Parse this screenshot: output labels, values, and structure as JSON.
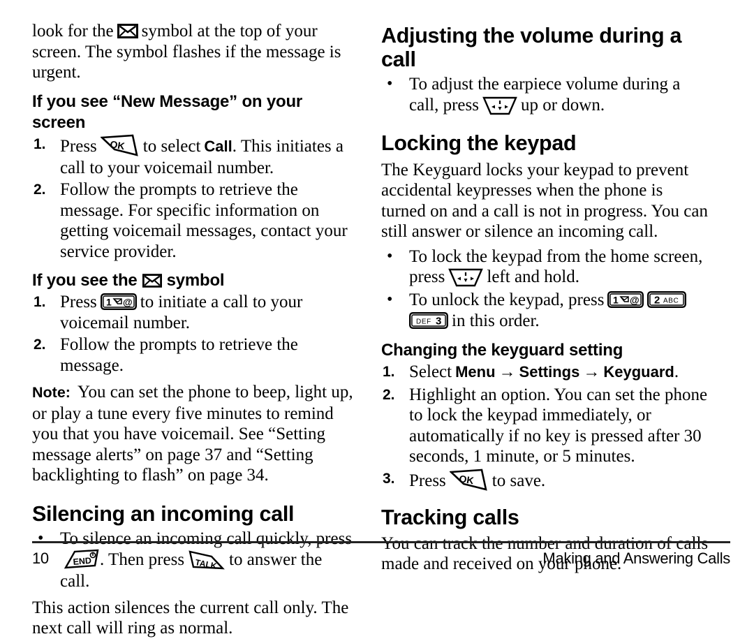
{
  "page": {
    "number": "10",
    "chapter_title": "Making and Answering Calls"
  },
  "left_column": {
    "intro_paragraph": "look for the  symbol at the top of your screen. The symbol flashes if the message is urgent.",
    "intro_part1": "look for the",
    "intro_part2": "symbol at the top of your screen. The symbol flashes if the message is urgent.",
    "subhead_new_message": "If you see “New Message” on your screen",
    "step1_new_message_a": "Press",
    "step1_new_message_b": "to select",
    "step1_new_message_bold": "Call",
    "step1_new_message_c": ". This initiates a call to your voicemail number.",
    "step2_new_message": "Follow the prompts to retrieve the message. For specific information on getting voicemail messages, contact your service provider.",
    "subhead_symbol_a": "If you see the",
    "subhead_symbol_b": "symbol",
    "step1_symbol_a": "Press",
    "step1_symbol_b": "to initiate a call to your voicemail number.",
    "step2_symbol": "Follow the prompts to retrieve the message.",
    "note_label": "Note:",
    "note_text": "You can set the phone to beep, light up, or play a tune every five minutes to remind you that you have voicemail. See “Setting message alerts” on page 37 and “Setting backlighting to flash” on page 34.",
    "heading_silencing": "Silencing an incoming call",
    "silence_bullet_a": "To silence an incoming call quickly, press",
    "silence_bullet_b": ". Then press",
    "silence_bullet_c": "to answer the call.",
    "silence_paragraph": "This action silences the current call only. The next call will ring as normal."
  },
  "right_column": {
    "heading_volume": "Adjusting the volume during a call",
    "volume_bullet_a": "To adjust the earpiece volume during a call, press",
    "volume_bullet_b": "up or down.",
    "heading_locking": "Locking the keypad",
    "locking_paragraph": "The Keyguard locks your keypad to prevent accidental keypresses when the phone is turned on and a call is not in progress. You can still answer or silence an incoming call.",
    "lock_bullet_a": "To lock the keypad from the home screen, press",
    "lock_bullet_b": "left and hold.",
    "unlock_bullet_a": "To unlock the keypad, press",
    "unlock_bullet_b": "in this order.",
    "subhead_changing": "Changing the keyguard setting",
    "step1_select": "Select",
    "step1_menu": "Menu",
    "step1_arrow1": "→",
    "step1_settings": "Settings",
    "step1_arrow2": "→",
    "step1_keyguard": "Keyguard",
    "step1_period": ".",
    "step2_highlight": "Highlight an option. You can set the phone to lock the keypad immediately, or automatically if no key is pressed after 30 seconds, 1 minute, or 5 minutes.",
    "step3_press_a": "Press",
    "step3_press_b": "to save.",
    "heading_tracking": "Tracking calls",
    "tracking_paragraph": "You can track the number and duration of calls made and received on your phone."
  },
  "icons": {
    "envelope": "envelope-icon",
    "key_1_voicemail": "key-1-voicemail-icon",
    "key_2_abc": "key-2-abc-icon",
    "key_3_def": "key-3-def-icon",
    "key_1_label_digit": "1",
    "key_1_label_at": "@",
    "key_2_label_digit": "2",
    "key_2_label_letters": "ABC",
    "key_3_label_digit": "3",
    "key_3_label_letters": "DEF",
    "softkey_ok": "OK",
    "softkey_talk": "TALK",
    "softkey_end": "END",
    "nav_key": "navigation-key-icon"
  },
  "colors": {
    "text": "#000000",
    "background": "#ffffff",
    "rule": "#222222"
  }
}
